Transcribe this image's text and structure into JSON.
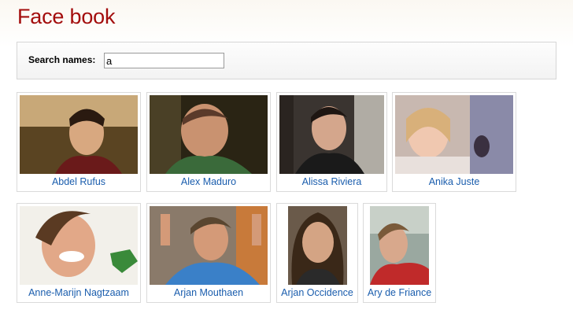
{
  "page": {
    "title": "Face book"
  },
  "search": {
    "label": "Search names:",
    "value": "a"
  },
  "people": [
    {
      "name": "Abdel Rufus"
    },
    {
      "name": "Alex Maduro"
    },
    {
      "name": "Alissa Riviera"
    },
    {
      "name": "Anika Juste"
    },
    {
      "name": "Anne-Marijn Nagtzaam"
    },
    {
      "name": "Arjan Mouthaen"
    },
    {
      "name": "Arjan Occidence"
    },
    {
      "name": "Ary de Friance"
    }
  ]
}
